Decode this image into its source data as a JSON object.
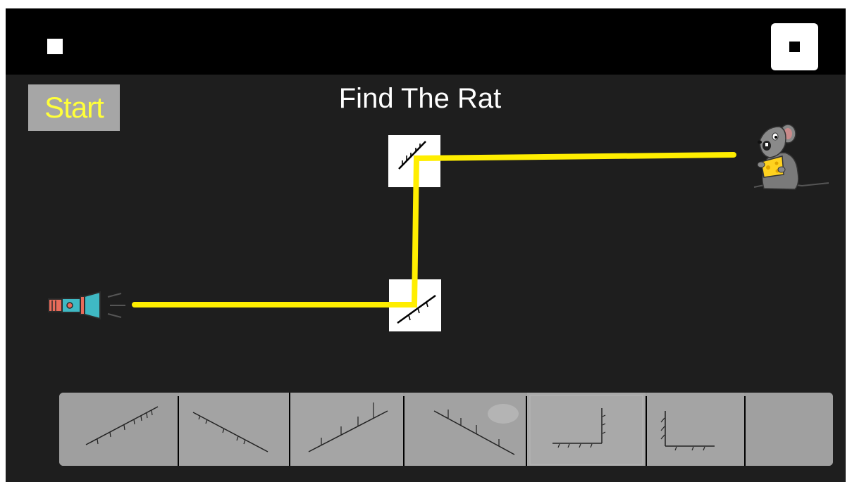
{
  "game": {
    "title": "Find The Rat",
    "start_label": "Start",
    "icons": {
      "menu": "square-icon",
      "stop": "stop-icon",
      "source": "flashlight-icon",
      "target": "rat-icon",
      "mirror": "mirror-icon"
    },
    "colors": {
      "background": "#1e1e1e",
      "topbar": "#000000",
      "beam": "#ffee00",
      "start_text": "#ffff3a",
      "start_bg": "#a6a6a6",
      "tray": "#9f9f9f"
    },
    "placed_mirrors": [
      {
        "name": "mirror-top",
        "orientation": "diagonal-rising"
      },
      {
        "name": "mirror-bottom",
        "orientation": "diagonal-rising"
      }
    ],
    "tray_pieces": [
      {
        "name": "tray-mirror-rising",
        "type": "rising"
      },
      {
        "name": "tray-mirror-falling",
        "type": "falling"
      },
      {
        "name": "tray-mirror-rising-steep",
        "type": "rising"
      },
      {
        "name": "tray-mirror-falling-steep",
        "type": "falling"
      },
      {
        "name": "tray-corner-right",
        "type": "corner"
      },
      {
        "name": "tray-corner-left",
        "type": "corner"
      },
      {
        "name": "tray-empty-slot",
        "type": "empty"
      }
    ]
  }
}
